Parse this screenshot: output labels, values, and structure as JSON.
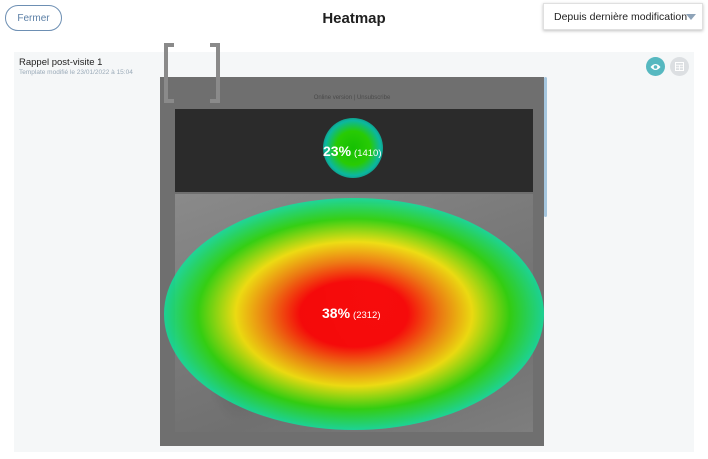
{
  "header": {
    "close_label": "Fermer",
    "title": "Heatmap",
    "period_select": {
      "value": "Depuis dernière modification"
    }
  },
  "template": {
    "name": "Rappel post-visite 1",
    "subtitle": "Template modifié le 23/01/2022 à 15:04"
  },
  "actions": [
    {
      "icon": "eye-icon",
      "color": "#56b8c0"
    },
    {
      "icon": "grid-icon",
      "color": "#dcdfe2"
    }
  ],
  "email_preview": {
    "top_link": "Online version | Unsubscribe"
  },
  "heat_zones": [
    {
      "name": "logo",
      "percent": "23%",
      "count": "(1410)"
    },
    {
      "name": "hero-image",
      "percent": "38%",
      "count": "(2312)"
    }
  ]
}
